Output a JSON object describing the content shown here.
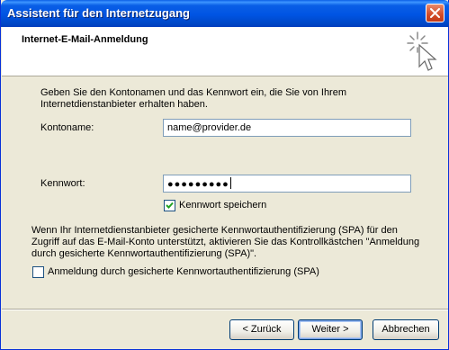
{
  "window": {
    "title": "Assistent für den Internetzugang",
    "close_icon": "close-icon"
  },
  "header": {
    "title": "Internet-E-Mail-Anmeldung",
    "icon": "wizard-star-cursor-icon"
  },
  "intro": "Geben Sie den Kontonamen und das Kennwort ein, die Sie von Ihrem Internetdienstanbieter erhalten haben.",
  "account": {
    "label": "Kontoname:",
    "value": "name@provider.de"
  },
  "password": {
    "label": "Kennwort:",
    "masked_value": "●●●●●●●●●"
  },
  "save_password": {
    "label": "Kennwort speichern",
    "checked": true
  },
  "spa": {
    "text": "Wenn Ihr Internetdienstanbieter gesicherte Kennwortauthentifizierung (SPA) für den Zugriff auf das E-Mail-Konto unterstützt, aktivieren Sie das Kontrollkästchen \"Anmeldung durch gesicherte Kennwortauthentifizierung (SPA)\".",
    "checkbox_label": "Anmeldung durch gesicherte Kennwortauthentifizierung (SPA)",
    "checked": false
  },
  "buttons": {
    "back": "< Zurück",
    "next": "Weiter >",
    "cancel": "Abbrechen"
  },
  "colors": {
    "titlebar": "#0054e3",
    "dialog_bg": "#ece9d8",
    "close_button": "#d24a27",
    "checkmark": "#21a121"
  }
}
